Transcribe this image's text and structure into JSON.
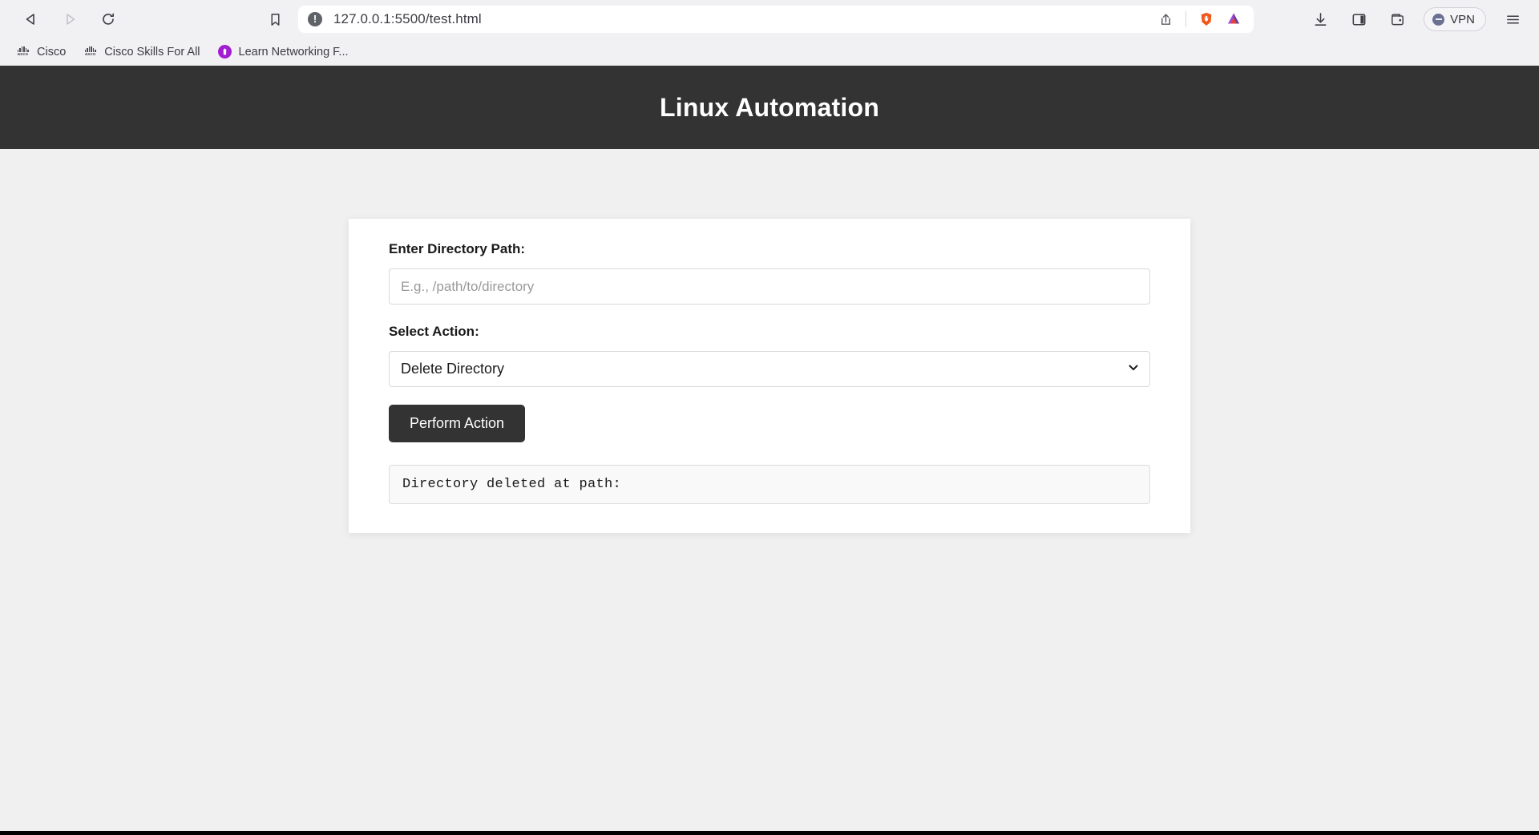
{
  "browser": {
    "nav": {
      "back_title": "Back",
      "forward_title": "Forward",
      "reload_title": "Reload"
    },
    "omnibox": {
      "bookmark_title": "Bookmark this page",
      "security_glyph": "!",
      "security_title": "Not secure",
      "url": "127.0.0.1:5500/test.html",
      "share_title": "Share",
      "brave_shields_title": "Brave Shields",
      "bat_rewards_title": "Brave Rewards"
    },
    "toolbar_right": {
      "downloads_title": "Downloads",
      "sidebar_title": "Sidebar",
      "wallet_title": "Brave Wallet",
      "vpn_label": "VPN",
      "menu_title": "Customize and control Brave"
    },
    "bookmarks": [
      {
        "label": "Cisco",
        "icon": "cisco-icon"
      },
      {
        "label": "Cisco Skills For All",
        "icon": "cisco-icon"
      },
      {
        "label": "Learn Networking F...",
        "icon": "purple-circle-icon"
      }
    ],
    "cisco_wordmark": "asco"
  },
  "page": {
    "header_title": "Linux Automation",
    "form": {
      "path_label": "Enter Directory Path:",
      "path_value": "",
      "path_placeholder": "E.g., /path/to/directory",
      "action_label": "Select Action:",
      "action_selected": "Delete Directory",
      "action_options": [
        "Delete Directory"
      ],
      "submit_label": "Perform Action"
    },
    "output": {
      "text": "Directory deleted at path:"
    }
  },
  "colors": {
    "header_bg": "#333333",
    "page_bg": "#f0f0f0",
    "card_bg": "#ffffff",
    "button_bg": "#333333",
    "accent_purple": "#a21ed0",
    "brave_orange": "#f1581b",
    "vpn_dot": "#6b7193"
  }
}
